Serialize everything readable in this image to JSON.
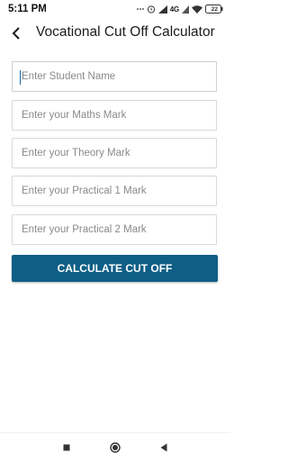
{
  "status_bar": {
    "time": "5:11 PM",
    "network": "4G",
    "battery": "22",
    "icons": [
      "dots-icon",
      "alarm-icon",
      "signal-icon",
      "wifi-icon",
      "battery-icon"
    ]
  },
  "app_bar": {
    "title": "Vocational Cut Off Calculator",
    "back_icon": "back-arrow-icon"
  },
  "form": {
    "student_name_placeholder": "Enter Student Name",
    "maths_placeholder": "Enter your Maths Mark",
    "theory_placeholder": "Enter your Theory Mark",
    "practical1_placeholder": "Enter your Practical 1 Mark",
    "practical2_placeholder": "Enter your Practical 2 Mark",
    "student_name_value": "",
    "maths_value": "",
    "theory_value": "",
    "practical1_value": "",
    "practical2_value": ""
  },
  "actions": {
    "calculate_label": "CALCULATE CUT OFF"
  },
  "nav_bar": {
    "buttons": [
      "recents-square-icon",
      "home-circle-icon",
      "back-triangle-icon"
    ]
  },
  "colors": {
    "button_bg": "#0e5e86",
    "button_text": "#ffffff",
    "field_border": "#d9d9d9",
    "placeholder": "#8a8a8a",
    "caret": "#1a6aa8"
  }
}
